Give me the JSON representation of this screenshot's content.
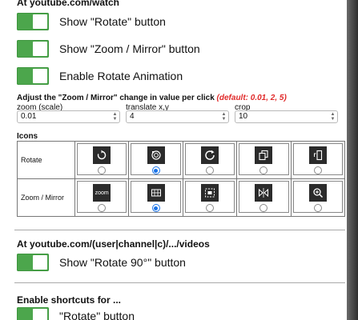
{
  "watch_section": {
    "title": "At youtube.com/watch",
    "toggles": [
      {
        "label": "Show \"Rotate\" button",
        "on": true
      },
      {
        "label": "Show \"Zoom / Mirror\" button",
        "on": true
      },
      {
        "label": "Enable Rotate Animation",
        "on": true
      }
    ]
  },
  "adjust": {
    "text": "Adjust the \"Zoom / Mirror\" change in value per click",
    "default_hint": "(default: 0.01, 2, 5)",
    "fields": [
      {
        "label": "zoom (scale)",
        "value": "0.01"
      },
      {
        "label": "translate x,y",
        "value": "4"
      },
      {
        "label": "crop",
        "value": "10"
      }
    ]
  },
  "icons": {
    "title": "Icons",
    "rows": [
      {
        "label": "Rotate",
        "selected_index": 1,
        "icons": [
          "rotate-ccw-icon",
          "rotate-90-icon",
          "rotate-cw-icon",
          "copy-pages-icon",
          "rotate-phone-icon"
        ]
      },
      {
        "label": "Zoom / Mirror",
        "selected_index": 1,
        "icons": [
          "zoom-text-icon",
          "crop-grid-icon",
          "zoom-frame-icon",
          "mirror-flip-icon",
          "zoom-in-icon"
        ]
      }
    ],
    "zoom_text": "zoom"
  },
  "videos_section": {
    "title": "At youtube.com/(user|channel|c)/.../videos",
    "toggle": {
      "label": "Show \"Rotate 90°\" button",
      "on": true
    }
  },
  "shortcuts_section": {
    "title": "Enable shortcuts for ...",
    "toggle": {
      "label": "\"Rotate\" button",
      "on": true
    }
  },
  "colors": {
    "toggle_on": "#4ca64c",
    "radio_selected": "#1a73e8",
    "hint": "#e02a2a"
  }
}
